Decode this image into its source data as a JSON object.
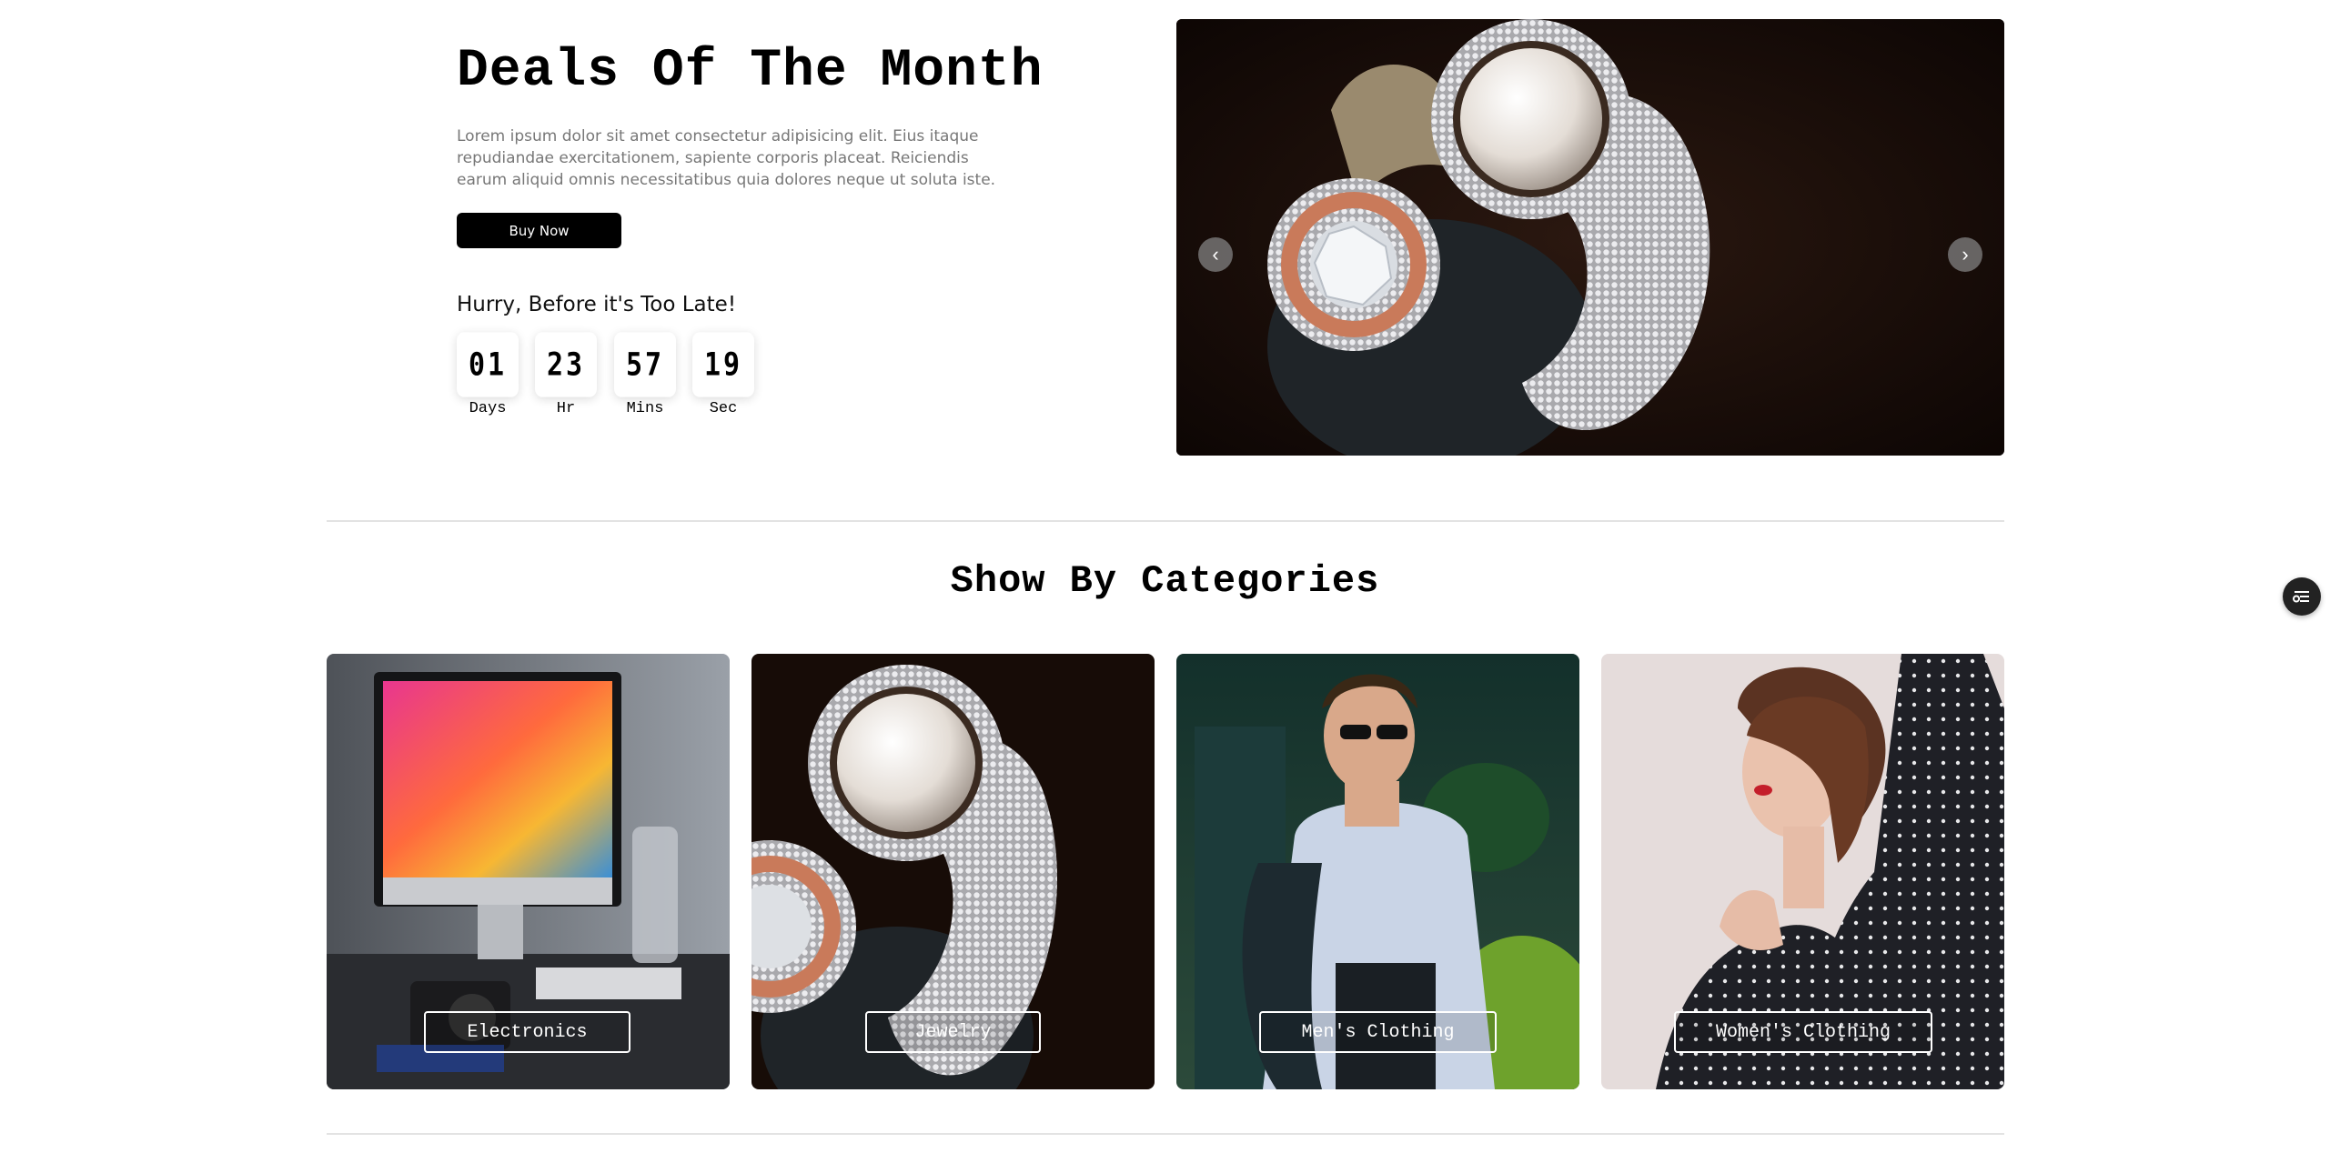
{
  "deal": {
    "title": "Deals Of The Month",
    "description": "Lorem ipsum dolor sit amet consectetur adipisicing elit. Eius itaque repudiandae exercitationem, sapiente corporis placeat. Reiciendis earum aliquid omnis necessitatibus quia dolores neque ut soluta iste.",
    "button_label": "Buy Now",
    "hurry_text": "Hurry, Before it's Too Late!"
  },
  "countdown": [
    {
      "value": "01",
      "label": "Days"
    },
    {
      "value": "23",
      "label": "Hr"
    },
    {
      "value": "57",
      "label": "Mins"
    },
    {
      "value": "19",
      "label": "Sec"
    }
  ],
  "carousel": {
    "prev_icon": "chevron-left-icon",
    "next_icon": "chevron-right-icon",
    "prev_glyph": "‹",
    "next_glyph": "›"
  },
  "categories": {
    "title": "Show By Categories",
    "items": [
      {
        "label": "Electronics"
      },
      {
        "label": "Jewelry"
      },
      {
        "label": "Men's Clothing"
      },
      {
        "label": "Women's Clothing"
      }
    ]
  },
  "floating": {
    "icon": "filter-settings-icon"
  },
  "colors": {
    "primary": "#000000",
    "text_muted": "#777777",
    "divider": "#e3e3e3"
  }
}
